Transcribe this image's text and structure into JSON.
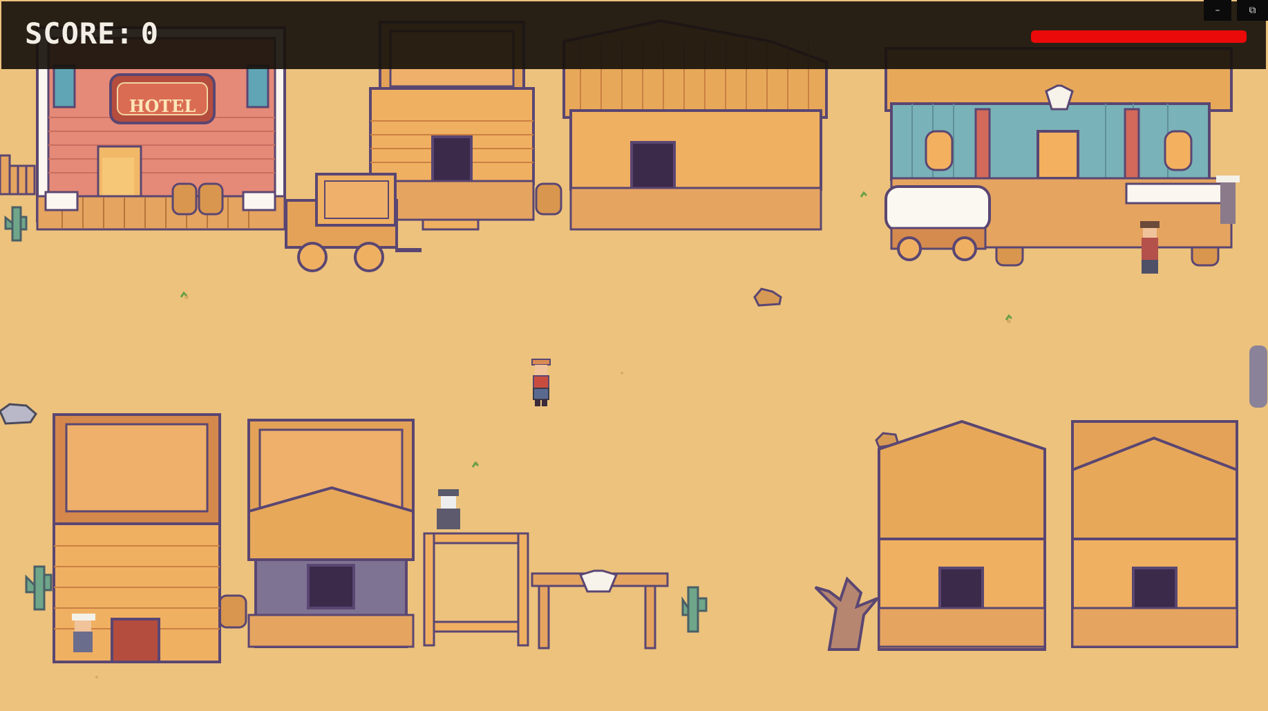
{
  "hud": {
    "score_label": "SCORE:",
    "score_value": "0",
    "health_fraction": 1.0
  },
  "signs": {
    "hotel": "HOTEL"
  },
  "window_controls": {
    "minimize_icon": "–",
    "restore_icon": "⧉"
  },
  "colors": {
    "sand": "#ecc27d",
    "hud_background": "#18120c",
    "health": "#ea0a0a",
    "hotel_wall": "#e58a78",
    "saloon_wall": "#79b2b8",
    "wood": "#e7a85a",
    "outline": "#5a4672"
  }
}
